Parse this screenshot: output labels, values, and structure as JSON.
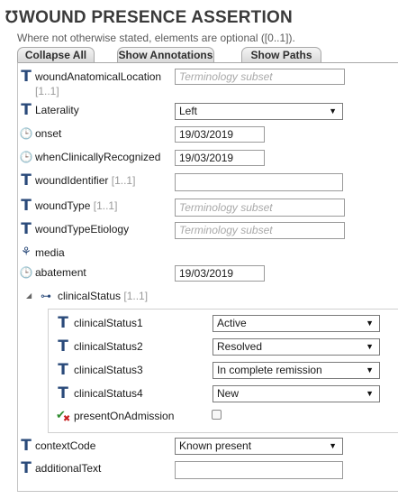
{
  "header": {
    "title": "WOUND PRESENCE ASSERTION",
    "subtitle": "Where not otherwise stated, elements are optional ([0..1])."
  },
  "toolbar": {
    "collapse_all": "Collapse All",
    "show_annotations": "Show Annotations",
    "show_paths": "Show Paths"
  },
  "fields": {
    "woundAnatomicalLocation": {
      "label": "woundAnatomicalLocation",
      "card": "[1..1]",
      "placeholder": "Terminology subset"
    },
    "laterality": {
      "label": "Laterality",
      "value": "Left"
    },
    "onset": {
      "label": "onset",
      "value": "19/03/2019"
    },
    "whenClinicallyRecognized": {
      "label": "whenClinicallyRecognized",
      "value": "19/03/2019"
    },
    "woundIdentifier": {
      "label": "woundIdentifier",
      "card": "[1..1]",
      "value": ""
    },
    "woundType": {
      "label": "woundType",
      "card": "[1..1]",
      "placeholder": "Terminology subset"
    },
    "woundTypeEtiology": {
      "label": "woundTypeEtiology",
      "placeholder": "Terminology subset"
    },
    "media": {
      "label": "media"
    },
    "abatement": {
      "label": "abatement",
      "value": "19/03/2019"
    },
    "clinicalStatus": {
      "label": "clinicalStatus",
      "card": "[1..1]",
      "items": [
        {
          "label": "clinicalStatus1",
          "value": "Active"
        },
        {
          "label": "clinicalStatus2",
          "value": "Resolved"
        },
        {
          "label": "clinicalStatus3",
          "value": "In complete remission"
        },
        {
          "label": "clinicalStatus4",
          "value": "New"
        }
      ],
      "presentOnAdmission": {
        "label": "presentOnAdmission",
        "checked": false
      }
    },
    "contextCode": {
      "label": "contextCode",
      "value": "Known present"
    },
    "additionalText": {
      "label": "additionalText",
      "value": ""
    }
  },
  "icons": {
    "title": "stethoscope-icon",
    "text": "text-type-icon",
    "date": "date-type-icon",
    "media": "media-icon",
    "cluster": "cluster-icon",
    "boolean": "checkmark-icon"
  },
  "colors": {
    "icon_blue": "#2a4a7a",
    "title_gray": "#3a3a3a",
    "placeholder": "#a9a9a9",
    "card_gray": "#9a9a9a"
  }
}
